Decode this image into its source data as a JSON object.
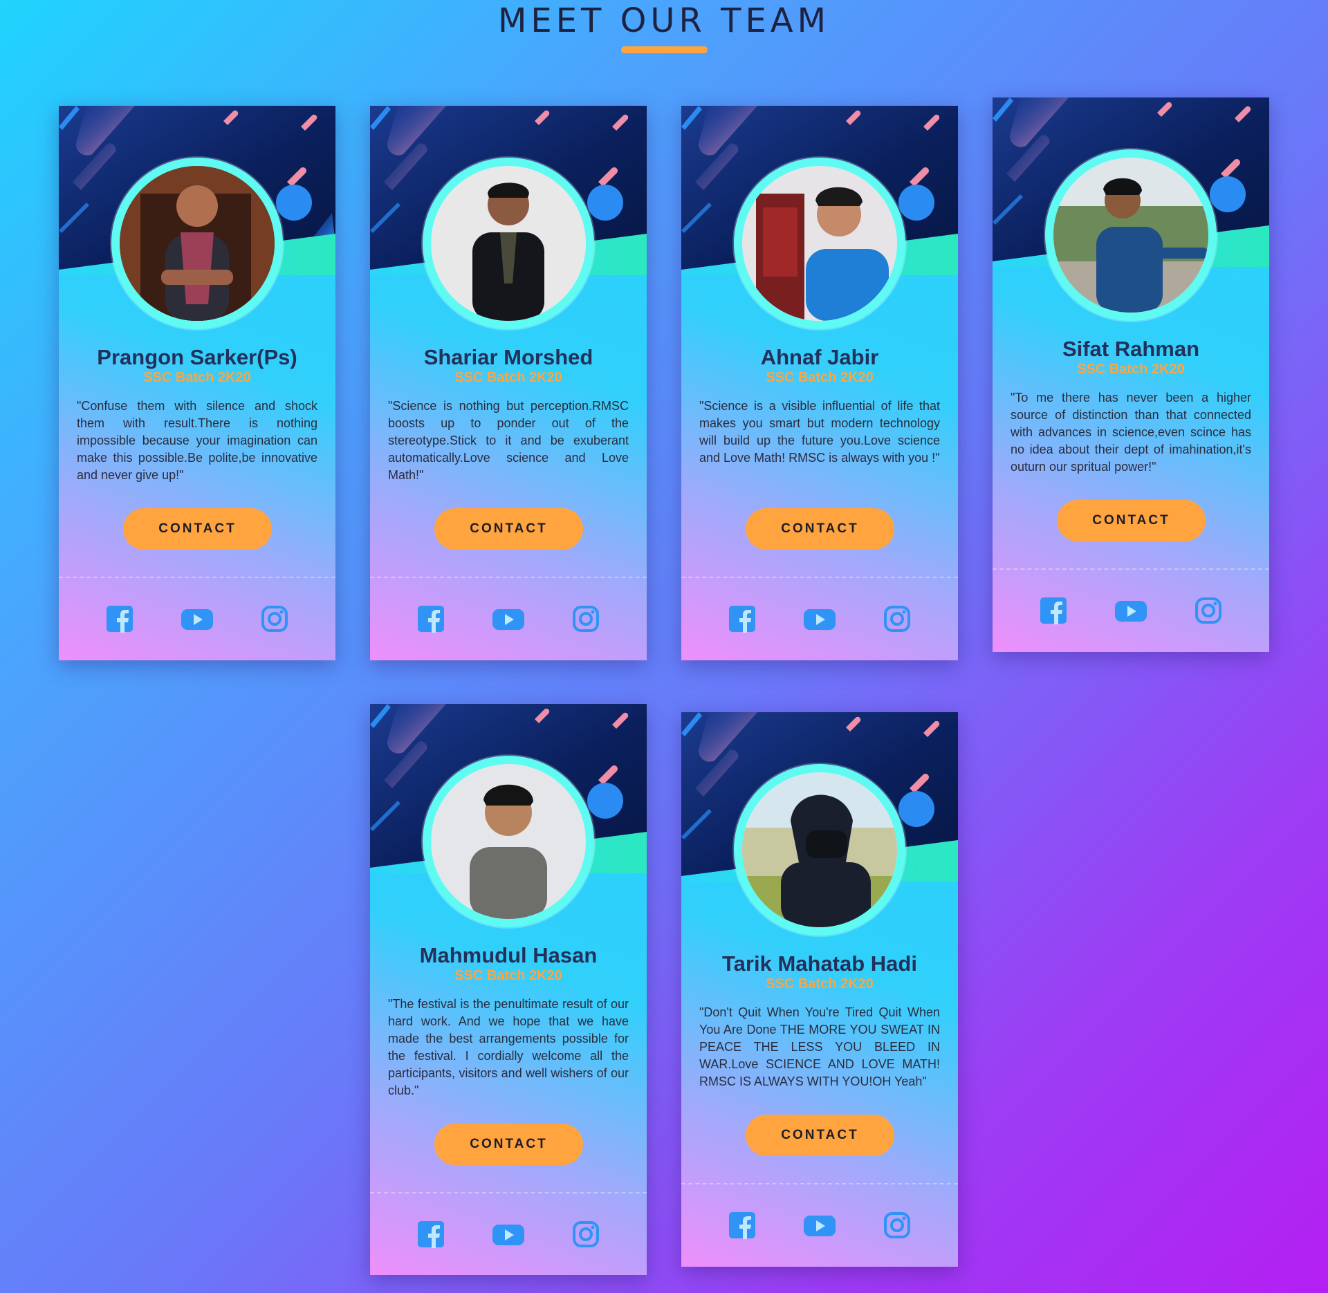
{
  "page": {
    "title": "MEET OUR TEAM",
    "accent_color": "#ffa43f",
    "icon_color": "#2f94f5"
  },
  "team": [
    {
      "name": "Prangon Sarker(Ps)",
      "batch": "SSC Batch 2K20",
      "quote": "\"Confuse them with silence and shock them with result.There is nothing impossible because your imagination can make this possible.Be polite,be innovative and never give up!\"",
      "contact_label": "CONTACT",
      "photo": "photo-of-team-member"
    },
    {
      "name": "Shariar Morshed",
      "batch": "SSC Batch 2K20",
      "quote": "\"Science is nothing but perception.RMSC boosts up to ponder out of the stereotype.Stick to it and be exuberant automatically.Love science and Love Math!\"",
      "contact_label": "CONTACT",
      "photo": "photo-of-team-member"
    },
    {
      "name": "Ahnaf Jabir",
      "batch": "SSC Batch 2K20",
      "quote": "\"Science is a visible influential of life that makes you smart but modern technology will build up the future you.Love science and Love Math! RMSC is always with you !\"",
      "contact_label": "CONTACT",
      "photo": "photo-of-team-member"
    },
    {
      "name": "Sifat Rahman",
      "batch": "SSC Batch 2K20",
      "quote": "\"To me there has never been a higher source of distinction than that connected with advances in science,even scince has no idea about their dept of imahination,it's outurn our spritual power!\"",
      "contact_label": "CONTACT",
      "photo": "photo-of-team-member"
    },
    {
      "name": "Mahmudul Hasan",
      "batch": "SSC Batch 2K20",
      "quote": "\"The festival is the penultimate result of our hard work. And we hope that we have made the best arrangements possible for the festival. I cordially welcome all the participants, visitors and well wishers of our club.\"",
      "contact_label": "CONTACT",
      "photo": "photo-of-team-member"
    },
    {
      "name": "Tarik Mahatab Hadi",
      "batch": "SSC Batch 2K20",
      "quote": "\"Don't Quit When You're Tired Quit When You Are Done THE MORE YOU SWEAT IN PEACE THE LESS YOU BLEED IN WAR.Love SCIENCE AND LOVE MATH! RMSC IS ALWAYS WITH YOU!OH Yeah\"",
      "contact_label": "CONTACT",
      "photo": "photo-of-team-member"
    }
  ],
  "social_icons": [
    "facebook-icon",
    "youtube-icon",
    "instagram-icon"
  ]
}
